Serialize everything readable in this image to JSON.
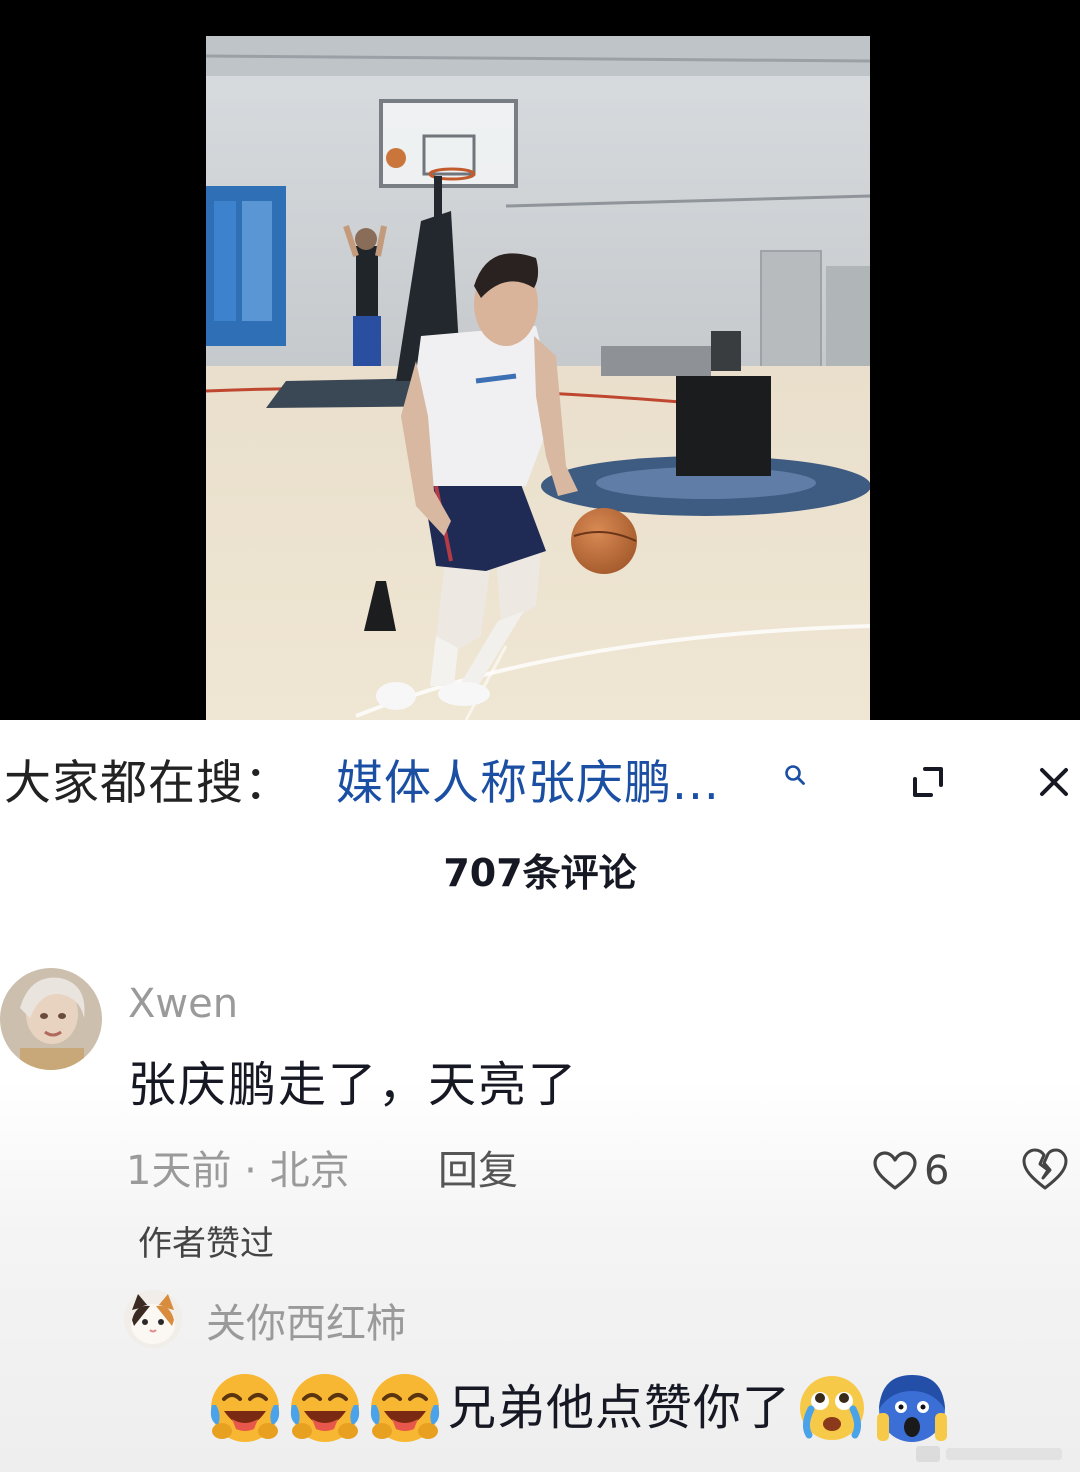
{
  "search": {
    "prefix": "大家都在搜：",
    "term": "媒体人称张庆鹏..."
  },
  "comments_header": {
    "count_label": "707条评论"
  },
  "comment": {
    "username": "Xwen",
    "text": "张庆鹏走了，天亮了",
    "meta": "1天前 · 北京",
    "reply_label": "回复",
    "like_count": "6",
    "author_badge": "作者赞过"
  },
  "reply": {
    "username": "关你西红柿",
    "emojis_before": [
      "laugh-cry-emoji",
      "laugh-cry-emoji",
      "laugh-cry-emoji"
    ],
    "text": "兄弟他点赞你了",
    "emojis_after": [
      "cry-emoji",
      "scream-emoji"
    ]
  },
  "colors": {
    "search_term": "#1a4fa3",
    "secondary_text": "#9a9a9a",
    "primary_text": "#161823"
  }
}
